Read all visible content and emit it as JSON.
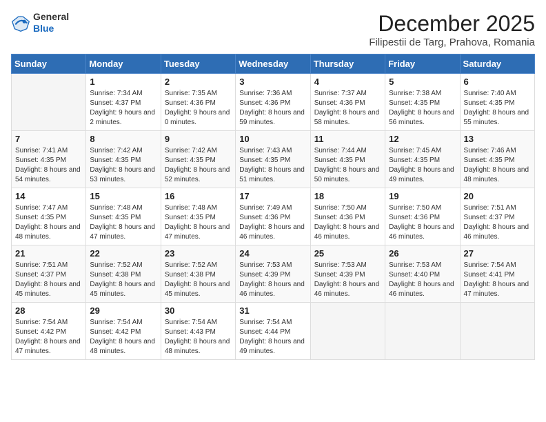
{
  "header": {
    "logo_general": "General",
    "logo_blue": "Blue",
    "month_title": "December 2025",
    "location": "Filipestii de Targ, Prahova, Romania"
  },
  "days_of_week": [
    "Sunday",
    "Monday",
    "Tuesday",
    "Wednesday",
    "Thursday",
    "Friday",
    "Saturday"
  ],
  "weeks": [
    [
      {
        "day": "",
        "sunrise": "",
        "sunset": "",
        "daylight": ""
      },
      {
        "day": "1",
        "sunrise": "Sunrise: 7:34 AM",
        "sunset": "Sunset: 4:37 PM",
        "daylight": "Daylight: 9 hours and 2 minutes."
      },
      {
        "day": "2",
        "sunrise": "Sunrise: 7:35 AM",
        "sunset": "Sunset: 4:36 PM",
        "daylight": "Daylight: 9 hours and 0 minutes."
      },
      {
        "day": "3",
        "sunrise": "Sunrise: 7:36 AM",
        "sunset": "Sunset: 4:36 PM",
        "daylight": "Daylight: 8 hours and 59 minutes."
      },
      {
        "day": "4",
        "sunrise": "Sunrise: 7:37 AM",
        "sunset": "Sunset: 4:36 PM",
        "daylight": "Daylight: 8 hours and 58 minutes."
      },
      {
        "day": "5",
        "sunrise": "Sunrise: 7:38 AM",
        "sunset": "Sunset: 4:35 PM",
        "daylight": "Daylight: 8 hours and 56 minutes."
      },
      {
        "day": "6",
        "sunrise": "Sunrise: 7:40 AM",
        "sunset": "Sunset: 4:35 PM",
        "daylight": "Daylight: 8 hours and 55 minutes."
      }
    ],
    [
      {
        "day": "7",
        "sunrise": "Sunrise: 7:41 AM",
        "sunset": "Sunset: 4:35 PM",
        "daylight": "Daylight: 8 hours and 54 minutes."
      },
      {
        "day": "8",
        "sunrise": "Sunrise: 7:42 AM",
        "sunset": "Sunset: 4:35 PM",
        "daylight": "Daylight: 8 hours and 53 minutes."
      },
      {
        "day": "9",
        "sunrise": "Sunrise: 7:42 AM",
        "sunset": "Sunset: 4:35 PM",
        "daylight": "Daylight: 8 hours and 52 minutes."
      },
      {
        "day": "10",
        "sunrise": "Sunrise: 7:43 AM",
        "sunset": "Sunset: 4:35 PM",
        "daylight": "Daylight: 8 hours and 51 minutes."
      },
      {
        "day": "11",
        "sunrise": "Sunrise: 7:44 AM",
        "sunset": "Sunset: 4:35 PM",
        "daylight": "Daylight: 8 hours and 50 minutes."
      },
      {
        "day": "12",
        "sunrise": "Sunrise: 7:45 AM",
        "sunset": "Sunset: 4:35 PM",
        "daylight": "Daylight: 8 hours and 49 minutes."
      },
      {
        "day": "13",
        "sunrise": "Sunrise: 7:46 AM",
        "sunset": "Sunset: 4:35 PM",
        "daylight": "Daylight: 8 hours and 48 minutes."
      }
    ],
    [
      {
        "day": "14",
        "sunrise": "Sunrise: 7:47 AM",
        "sunset": "Sunset: 4:35 PM",
        "daylight": "Daylight: 8 hours and 48 minutes."
      },
      {
        "day": "15",
        "sunrise": "Sunrise: 7:48 AM",
        "sunset": "Sunset: 4:35 PM",
        "daylight": "Daylight: 8 hours and 47 minutes."
      },
      {
        "day": "16",
        "sunrise": "Sunrise: 7:48 AM",
        "sunset": "Sunset: 4:35 PM",
        "daylight": "Daylight: 8 hours and 47 minutes."
      },
      {
        "day": "17",
        "sunrise": "Sunrise: 7:49 AM",
        "sunset": "Sunset: 4:36 PM",
        "daylight": "Daylight: 8 hours and 46 minutes."
      },
      {
        "day": "18",
        "sunrise": "Sunrise: 7:50 AM",
        "sunset": "Sunset: 4:36 PM",
        "daylight": "Daylight: 8 hours and 46 minutes."
      },
      {
        "day": "19",
        "sunrise": "Sunrise: 7:50 AM",
        "sunset": "Sunset: 4:36 PM",
        "daylight": "Daylight: 8 hours and 46 minutes."
      },
      {
        "day": "20",
        "sunrise": "Sunrise: 7:51 AM",
        "sunset": "Sunset: 4:37 PM",
        "daylight": "Daylight: 8 hours and 46 minutes."
      }
    ],
    [
      {
        "day": "21",
        "sunrise": "Sunrise: 7:51 AM",
        "sunset": "Sunset: 4:37 PM",
        "daylight": "Daylight: 8 hours and 45 minutes."
      },
      {
        "day": "22",
        "sunrise": "Sunrise: 7:52 AM",
        "sunset": "Sunset: 4:38 PM",
        "daylight": "Daylight: 8 hours and 45 minutes."
      },
      {
        "day": "23",
        "sunrise": "Sunrise: 7:52 AM",
        "sunset": "Sunset: 4:38 PM",
        "daylight": "Daylight: 8 hours and 45 minutes."
      },
      {
        "day": "24",
        "sunrise": "Sunrise: 7:53 AM",
        "sunset": "Sunset: 4:39 PM",
        "daylight": "Daylight: 8 hours and 46 minutes."
      },
      {
        "day": "25",
        "sunrise": "Sunrise: 7:53 AM",
        "sunset": "Sunset: 4:39 PM",
        "daylight": "Daylight: 8 hours and 46 minutes."
      },
      {
        "day": "26",
        "sunrise": "Sunrise: 7:53 AM",
        "sunset": "Sunset: 4:40 PM",
        "daylight": "Daylight: 8 hours and 46 minutes."
      },
      {
        "day": "27",
        "sunrise": "Sunrise: 7:54 AM",
        "sunset": "Sunset: 4:41 PM",
        "daylight": "Daylight: 8 hours and 47 minutes."
      }
    ],
    [
      {
        "day": "28",
        "sunrise": "Sunrise: 7:54 AM",
        "sunset": "Sunset: 4:42 PM",
        "daylight": "Daylight: 8 hours and 47 minutes."
      },
      {
        "day": "29",
        "sunrise": "Sunrise: 7:54 AM",
        "sunset": "Sunset: 4:42 PM",
        "daylight": "Daylight: 8 hours and 48 minutes."
      },
      {
        "day": "30",
        "sunrise": "Sunrise: 7:54 AM",
        "sunset": "Sunset: 4:43 PM",
        "daylight": "Daylight: 8 hours and 48 minutes."
      },
      {
        "day": "31",
        "sunrise": "Sunrise: 7:54 AM",
        "sunset": "Sunset: 4:44 PM",
        "daylight": "Daylight: 8 hours and 49 minutes."
      },
      {
        "day": "",
        "sunrise": "",
        "sunset": "",
        "daylight": ""
      },
      {
        "day": "",
        "sunrise": "",
        "sunset": "",
        "daylight": ""
      },
      {
        "day": "",
        "sunrise": "",
        "sunset": "",
        "daylight": ""
      }
    ]
  ]
}
